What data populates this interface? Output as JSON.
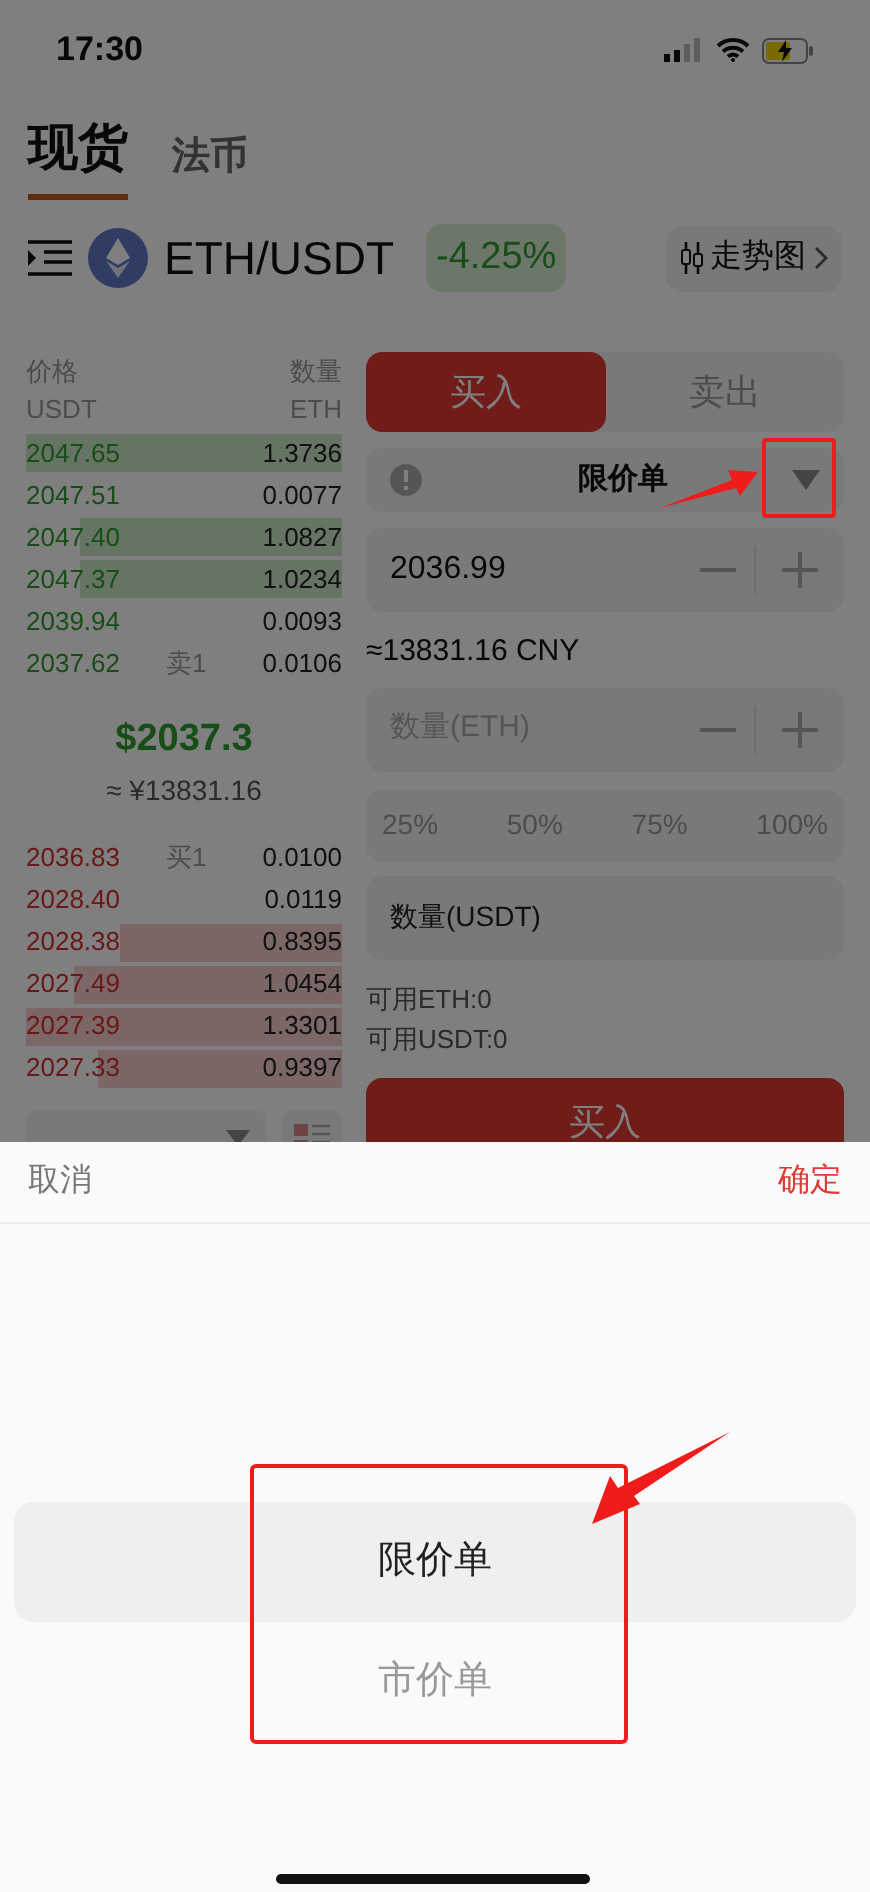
{
  "status_bar": {
    "time": "17:30"
  },
  "tabs": [
    {
      "label": "现货",
      "selected": true
    },
    {
      "label": "法币",
      "selected": false
    }
  ],
  "pair": {
    "symbol": "ETH/USDT",
    "change": "-4.25%",
    "chart_button": "走势图"
  },
  "order_book": {
    "headers": [
      {
        "top": "价格",
        "bottom": "USDT"
      },
      {
        "top": "数量",
        "bottom": "ETH"
      }
    ],
    "asks": [
      {
        "price": "2047.65",
        "amount": "1.3736",
        "level": 1.0
      },
      {
        "price": "2047.51",
        "amount": "0.0077",
        "level": 0
      },
      {
        "price": "2047.40",
        "amount": "1.0827",
        "level": 0.83
      },
      {
        "price": "2047.37",
        "amount": "1.0234",
        "level": 0.83
      },
      {
        "price": "2039.94",
        "amount": "0.0093",
        "level": 0
      },
      {
        "price": "2037.62",
        "tag": "卖1",
        "amount": "0.0106",
        "level": 0
      }
    ],
    "last_price": "$2037.3",
    "last_price_cny": "≈ ¥13831.16",
    "bids": [
      {
        "price": "2036.83",
        "tag": "买1",
        "amount": "0.0100",
        "level": 0
      },
      {
        "price": "2028.40",
        "amount": "0.0119",
        "level": 0
      },
      {
        "price": "2028.38",
        "amount": "0.8395",
        "level": 0.7
      },
      {
        "price": "2027.49",
        "amount": "1.0454",
        "level": 0.85
      },
      {
        "price": "2027.39",
        "amount": "1.3301",
        "level": 1.0
      },
      {
        "price": "2027.33",
        "amount": "0.9397",
        "level": 0.77
      }
    ]
  },
  "trade_form": {
    "sides": [
      {
        "label": "买入",
        "selected": true
      },
      {
        "label": "卖出",
        "selected": false
      }
    ],
    "order_type": "限价单",
    "price": "2036.99",
    "price_cny": "≈13831.16 CNY",
    "amount_placeholder": "数量(ETH)",
    "percentages": [
      "25%",
      "50%",
      "75%",
      "100%"
    ],
    "total_placeholder": "数量(USDT)",
    "available": [
      "可用ETH:0",
      "可用USDT:0"
    ],
    "submit": "买入"
  },
  "picker": {
    "cancel": "取消",
    "confirm": "确定",
    "options": [
      {
        "label": "限价单",
        "selected": true
      },
      {
        "label": "市价单",
        "selected": false
      }
    ]
  }
}
